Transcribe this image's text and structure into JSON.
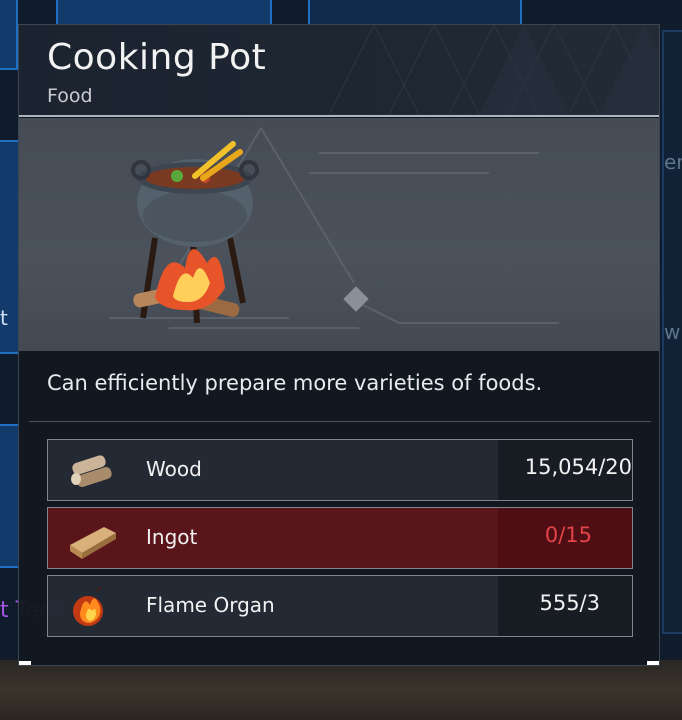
{
  "background": {
    "fragment_left": "t",
    "fragment_right_1": "em",
    "fragment_right_2": "w",
    "fragment_purple": "t Tech"
  },
  "tooltip": {
    "title": "Cooking Pot",
    "category": "Food",
    "image_icon": "cooking-pot-illustration",
    "description": "Can efficiently prepare more varieties of foods.",
    "materials": [
      {
        "name": "Wood",
        "quantity": "15,054/20",
        "icon": "wood-icon",
        "sufficient": true
      },
      {
        "name": "Ingot",
        "quantity": "0/15",
        "icon": "ingot-icon",
        "sufficient": false
      },
      {
        "name": "Flame Organ",
        "quantity": "555/3",
        "icon": "flame-organ-icon",
        "sufficient": true
      }
    ],
    "colors": {
      "insufficient_text": "#e2434a",
      "insufficient_row": "#6e1418"
    }
  }
}
